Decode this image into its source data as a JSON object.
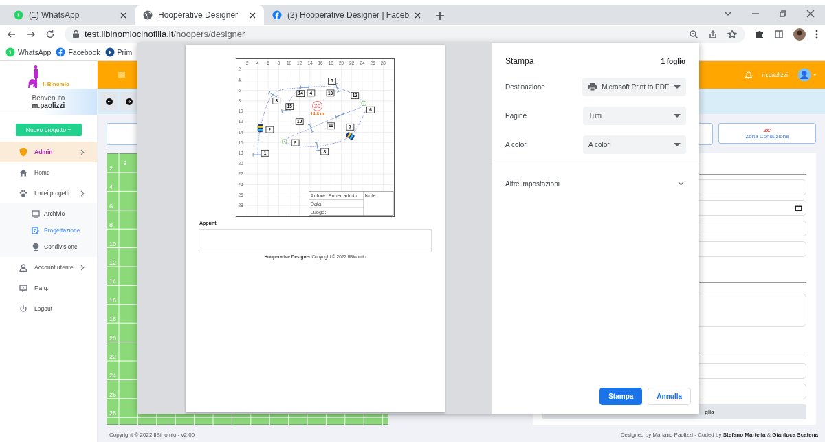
{
  "browser": {
    "tabs": [
      {
        "title": "(1) WhatsApp",
        "kind": "whatsapp",
        "selected": false
      },
      {
        "title": "Hooperative Designer",
        "kind": "globe",
        "selected": true
      },
      {
        "title": "(2) Hooperative Designer | Faceb",
        "kind": "facebook",
        "selected": false
      }
    ],
    "url": {
      "host": "test.ilbinomiocinofilia.it",
      "path": "/hoopers/designer"
    },
    "bookmarks": [
      {
        "label": "WhatsApp",
        "kind": "whatsapp"
      },
      {
        "label": "Facebook",
        "kind": "facebook"
      },
      {
        "label": "Prim",
        "kind": "play"
      }
    ]
  },
  "sidebar": {
    "logo": "Il Binomio",
    "welcome": "Benvenuto",
    "user": "m.paolizzi",
    "new_project": "Nuovo progetto +",
    "menu": [
      {
        "label": "Admin",
        "kind": "shield",
        "selected": true,
        "expandable": true
      },
      {
        "label": "Home",
        "kind": "home",
        "selected": false,
        "expandable": false
      },
      {
        "label": "I miei progetti",
        "kind": "paw",
        "selected": false,
        "expandable": true,
        "children": [
          {
            "label": "Archivio",
            "kind": "monitor",
            "selected": false
          },
          {
            "label": "Progettazione",
            "kind": "edit",
            "selected": true
          },
          {
            "label": "Condivisione",
            "kind": "globe",
            "selected": false
          }
        ]
      },
      {
        "label": "Account utente",
        "kind": "user",
        "selected": false,
        "expandable": true
      },
      {
        "label": "F.a.q.",
        "kind": "faq",
        "selected": false,
        "expandable": false
      },
      {
        "label": "Logout",
        "kind": "power",
        "selected": false,
        "expandable": false
      }
    ]
  },
  "header": {
    "user": "m.paolizzi"
  },
  "zone_card": {
    "badge": "ZC",
    "label": "Zona Conduzione"
  },
  "canvas": {
    "top_tick": "2",
    "left_ticks": [
      "2",
      "4",
      "6",
      "8",
      "10",
      "12",
      "14",
      "16",
      "18",
      "20",
      "22",
      "24",
      "26",
      "28"
    ]
  },
  "form": {
    "button_label": "glia"
  },
  "footer": {
    "copyright": "Copyright © 2022 IlBinomio - v2.00",
    "credits": "Designed by Mariano Paolizzi - Coded by **Stefano Martella** & **Gianluca Scatena**"
  },
  "print_dialog": {
    "title": "Stampa",
    "sheets": "1 foglio",
    "settings": [
      {
        "label": "Destinazione",
        "value": "Microsoft Print to PDF",
        "kind": "printer"
      },
      {
        "label": "Pagine",
        "value": "Tutti",
        "kind": "select"
      },
      {
        "label": "A colori",
        "value": "A colori",
        "kind": "select"
      }
    ],
    "more": "Altre impostazioni",
    "buttons": [
      {
        "label": "Stampa",
        "primary": true
      },
      {
        "label": "Annulla",
        "primary": false
      }
    ],
    "preview": {
      "x_ticks": [
        "2",
        "4",
        "6",
        "8",
        "10",
        "12",
        "14",
        "16",
        "18",
        "20",
        "22",
        "24",
        "26",
        "28"
      ],
      "y_ticks": [
        "2",
        "4",
        "6",
        "8",
        "10",
        "12",
        "14",
        "16",
        "18",
        "20",
        "22",
        "24",
        "26",
        "28"
      ],
      "items": [
        {
          "kind": "hoop"
        },
        {
          "kind": "hoop"
        },
        {
          "kind": "hoop"
        },
        {
          "kind": "hoop"
        },
        {
          "kind": "hoop"
        },
        {
          "kind": "hoop"
        },
        {
          "kind": "hoop"
        },
        {
          "kind": "hoop"
        },
        {
          "kind": "tunnel"
        },
        {
          "kind": "tunnel"
        },
        {
          "kind": "gate"
        },
        {
          "kind": "gate"
        },
        {
          "kind": "number",
          "label": "5"
        },
        {
          "kind": "number",
          "label": "14"
        },
        {
          "kind": "number",
          "label": "4"
        },
        {
          "kind": "number",
          "label": "13"
        },
        {
          "kind": "number",
          "label": "12"
        },
        {
          "kind": "number",
          "label": "3"
        },
        {
          "kind": "number",
          "label": "15"
        },
        {
          "kind": "number",
          "label": "6"
        },
        {
          "kind": "number",
          "label": "10"
        },
        {
          "kind": "number",
          "label": "11"
        },
        {
          "kind": "number",
          "label": "7"
        },
        {
          "kind": "number",
          "label": "2"
        },
        {
          "kind": "number",
          "label": "9"
        },
        {
          "kind": "number",
          "label": "8"
        },
        {
          "kind": "number",
          "label": "1"
        }
      ],
      "zone": {
        "badge": "ZC",
        "distance": "14.8 m"
      },
      "info": {
        "author": "Autore: Super admin",
        "date": "Data:",
        "place": "Luogo:",
        "notes": "Note:"
      },
      "notes_label": "Appunti",
      "footer": "**Hooperative Designer** Copyright © 2022 IlBinomio"
    }
  }
}
